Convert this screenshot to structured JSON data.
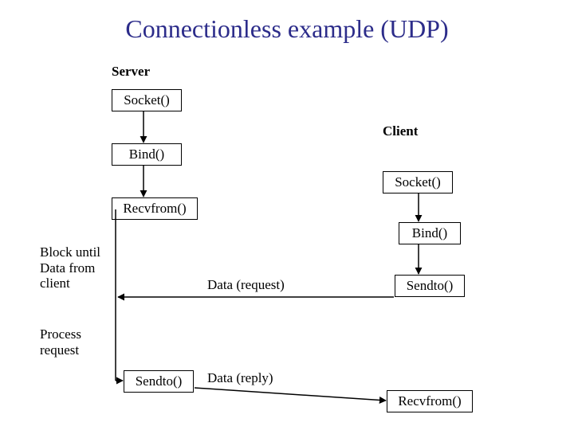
{
  "title": "Connectionless example (UDP)",
  "server": {
    "heading": "Server",
    "socket": "Socket()",
    "bind": "Bind()",
    "recvfrom": "Recvfrom()",
    "sendto": "Sendto()"
  },
  "client": {
    "heading": "Client",
    "socket": "Socket()",
    "bind": "Bind()",
    "sendto": "Sendto()",
    "recvfrom": "Recvfrom()"
  },
  "notes": {
    "block_until_l1": "Block until",
    "block_until_l2": "Data from",
    "block_until_l3": "client",
    "process_l1": "Process",
    "process_l2": "request",
    "data_request": "Data (request)",
    "data_reply": "Data (reply)"
  }
}
